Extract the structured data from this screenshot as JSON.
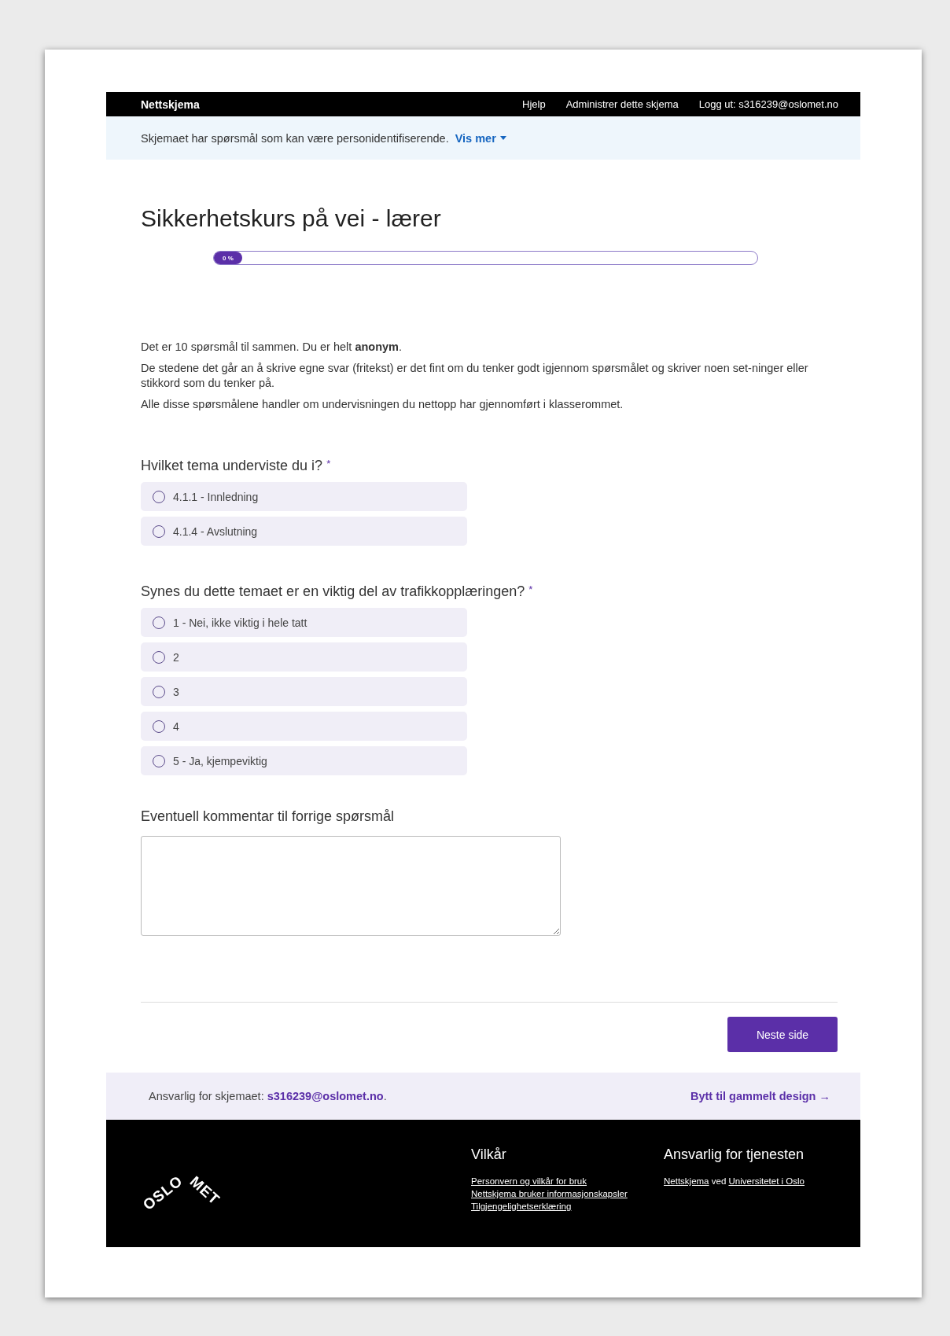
{
  "top_bar": {
    "brand": "Nettskjema",
    "links": [
      "Hjelp",
      "Administrer dette skjema",
      "Logg ut: s316239@oslomet.no"
    ]
  },
  "notice": {
    "text": "Skjemaet har spørsmål som kan være personidentifiserende.",
    "link": "Vis mer"
  },
  "title": "Sikkerhetskurs på vei - lærer",
  "progress": {
    "level": 0,
    "label": "0 %"
  },
  "intro": [
    "Det er 10 spørsmål til sammen. Du er helt **anonym**.",
    "De stedene det går an å skrive egne svar (fritekst) er det fint om du tenker godt igjennom spørsmålet og skriver noen set-ninger eller stikkord som du tenker på.",
    "Alle disse spørsmålene handler om undervisningen du nettopp har gjennomført i klasserommet."
  ],
  "questions": [
    {
      "kind": "radio",
      "label": "Hvilket tema underviste du i?",
      "required_mark": "*",
      "options": [
        {
          "label": "4.1.1 - Innledning",
          "selected": false
        },
        {
          "label": "4.1.4 - Avslutning",
          "selected": false
        }
      ]
    },
    {
      "kind": "radio",
      "label": "Synes du dette temaet er en viktig del av trafikkopplæringen?",
      "required_mark": "*",
      "options": [
        {
          "label": "1 - Nei, ikke viktig i hele tatt",
          "selected": false
        },
        {
          "label": "2",
          "selected": false
        },
        {
          "label": "3",
          "selected": false
        },
        {
          "label": "4",
          "selected": false
        },
        {
          "label": "5 - Ja, kjempeviktig",
          "selected": false
        }
      ]
    },
    {
      "kind": "text",
      "label": "Eventuell kommentar til forrige spørsmål"
    }
  ],
  "next_button": "Neste side",
  "owner_bar": {
    "prefix": "Ansvarlig for skjemaet:",
    "email": "s316239@oslomet.no",
    "suffix": ".",
    "switch_link": "Bytt til gammelt design",
    "switch_icon": "→"
  },
  "footer": {
    "logo": [
      "OSLO",
      "MET"
    ],
    "terms": {
      "heading": "Vilkår",
      "links": [
        "Personvern og vilkår for bruk",
        "Nettskjema bruker informasjonskapsler",
        "Tilgjengelighetserklæring"
      ]
    },
    "service": {
      "heading": "Ansvarlig for tjenesten",
      "link1": "Nettskjema",
      "middle": "ved",
      "link2": "Universitetet i Oslo"
    }
  }
}
